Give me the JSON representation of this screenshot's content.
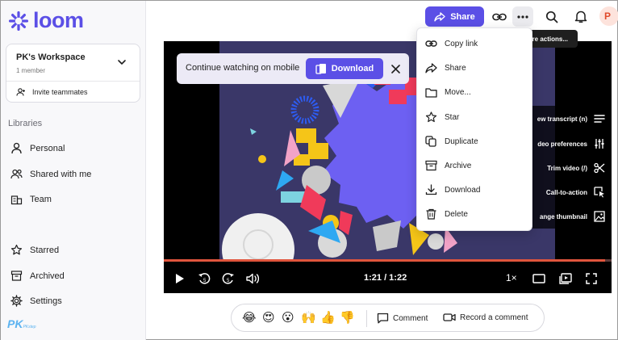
{
  "brand": {
    "name": "loom",
    "color": "#5b4fe6"
  },
  "workspace": {
    "name": "PK's Workspace",
    "members": "1 member",
    "invite_label": "Invite teammates"
  },
  "sidebar": {
    "libraries_label": "Libraries",
    "items": [
      {
        "label": "Personal",
        "icon": "person-icon"
      },
      {
        "label": "Shared with me",
        "icon": "people-icon"
      },
      {
        "label": "Team",
        "icon": "team-icon"
      },
      {
        "label": "Starred",
        "icon": "star-icon"
      },
      {
        "label": "Archived",
        "icon": "archive-icon"
      },
      {
        "label": "Settings",
        "icon": "gear-icon"
      }
    ]
  },
  "watermark": {
    "text": "PK",
    "small": "PKstep"
  },
  "topbar": {
    "share_label": "Share",
    "avatar_initial": "P",
    "tooltip": "More actions..."
  },
  "banner": {
    "text": "Continue watching on mobile",
    "download_label": "Download"
  },
  "menu": {
    "items": [
      {
        "label": "Copy link",
        "icon": "link-icon"
      },
      {
        "label": "Share",
        "icon": "share-icon"
      },
      {
        "label": "Move...",
        "icon": "folder-icon"
      },
      {
        "label": "Star",
        "icon": "star-icon"
      },
      {
        "label": "Duplicate",
        "icon": "duplicate-icon"
      },
      {
        "label": "Archive",
        "icon": "archive-icon"
      },
      {
        "label": "Download",
        "icon": "download-icon"
      },
      {
        "label": "Delete",
        "icon": "trash-icon"
      }
    ]
  },
  "side_panel": {
    "items": [
      {
        "label": "View transcript (n)",
        "visible": "ew transcript (n)",
        "icon": "transcript-icon"
      },
      {
        "label": "Video preferences",
        "visible": "deo preferences",
        "icon": "sliders-icon"
      },
      {
        "label": "Trim video (/)",
        "visible": "Trim video (/)",
        "icon": "scissors-icon"
      },
      {
        "label": "Call-to-action",
        "visible": "Call-to-action",
        "icon": "cursor-icon"
      },
      {
        "label": "Change thumbnail",
        "visible": "ange thumbnail",
        "icon": "image-icon"
      }
    ]
  },
  "player": {
    "time": "1:21 / 1:22",
    "speed": "1×",
    "progress": 0.985
  },
  "reactions": {
    "emojis": [
      "😂",
      "😍",
      "😮",
      "🙌",
      "👍",
      "👎"
    ],
    "comment_label": "Comment",
    "record_label": "Record a comment"
  }
}
